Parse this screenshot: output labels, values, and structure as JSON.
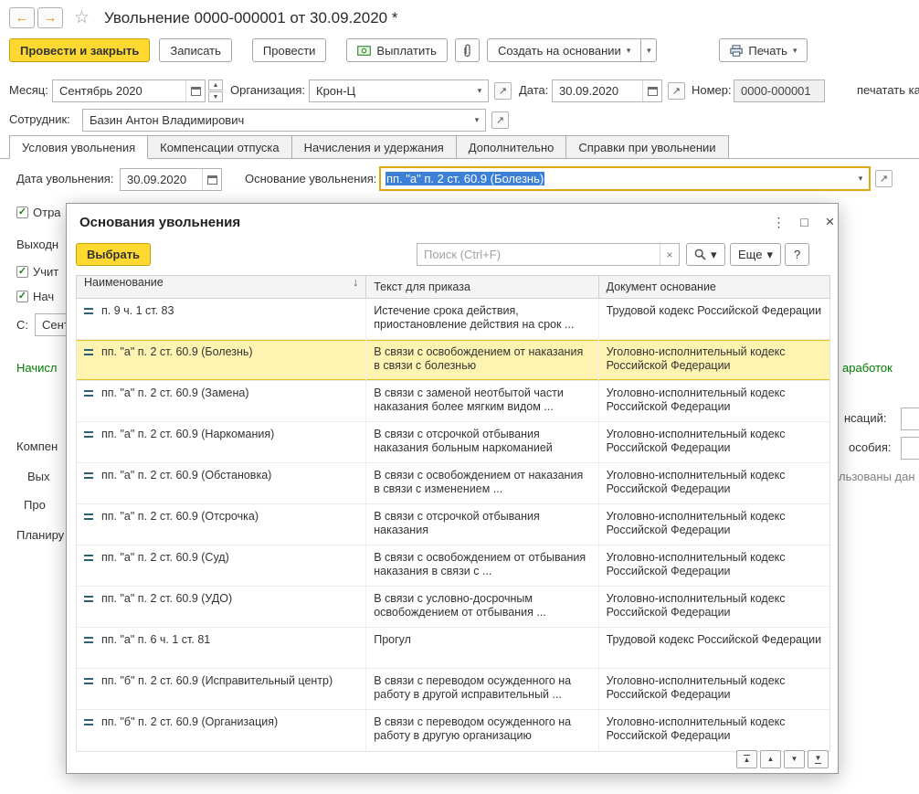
{
  "glyphs": {
    "back": "←",
    "forward": "→",
    "star": "☆",
    "dropdown": "▾",
    "open": "↗",
    "close": "×",
    "maximize": "□",
    "more_dots": "⋮",
    "clear": "×",
    "sort_desc": "↓",
    "check": "✓",
    "up": "▲",
    "down": "▼"
  },
  "window": {
    "title": "Увольнение 0000-000001 от 30.09.2020 *"
  },
  "toolbar": {
    "post_and_close": "Провести и закрыть",
    "write": "Записать",
    "post": "Провести",
    "pay": "Выплатить",
    "create_on_basis": "Создать на основании",
    "print": "Печать"
  },
  "fields": {
    "month_label": "Месяц:",
    "month_value": "Сентябрь 2020",
    "org_label": "Организация:",
    "org_value": "Крон-Ц",
    "date_label": "Дата:",
    "date_value": "30.09.2020",
    "number_label": "Номер:",
    "number_value": "0000-000001",
    "print_hint": "печатать ка",
    "employee_label": "Сотрудник:",
    "employee_value": "Базин Антон Владимирович"
  },
  "tabs": [
    "Условия увольнения",
    "Компенсации отпуска",
    "Начисления и удержания",
    "Дополнительно",
    "Справки при увольнении"
  ],
  "form": {
    "dismissal_date_label": "Дата увольнения:",
    "dismissal_date_value": "30.09.2020",
    "reason_label": "Основание увольнения:",
    "reason_value": "пп. \"а\" п. 2 ст. 60.9 (Болезнь)"
  },
  "background": {
    "otra": "Отра",
    "vyhodn": "Выходн",
    "uchit": "Учит",
    "nach": "Нач",
    "s_label": "С:",
    "s_value": "Сент",
    "nachisl": "Начисл",
    "kompen": "Компен",
    "vyh": "Вых",
    "pro": "Про",
    "planiru": "Планиру",
    "zarabotok": "аработок",
    "nsacij": "нсаций:",
    "osobiya": "особия:",
    "lzovany": "льзованы дан"
  },
  "modal": {
    "title": "Основания увольнения",
    "select_button": "Выбрать",
    "search_placeholder": "Поиск (Ctrl+F)",
    "more_button": "Еще",
    "help_button": "?",
    "columns": [
      "Наименование",
      "Текст для приказа",
      "Документ основание"
    ],
    "rows": [
      {
        "name": "п. 9 ч. 1 ст. 83",
        "text": "Истечение срока действия, приостановление действия на срок ...",
        "doc": "Трудовой кодекс Российской Федерации",
        "selected": false
      },
      {
        "name": "пп. \"а\" п. 2 ст. 60.9 (Болезнь)",
        "text": "В связи с освобождением от наказания в связи с болезнью",
        "doc": "Уголовно-исполнительный кодекс Российской Федерации",
        "selected": true
      },
      {
        "name": "пп. \"а\" п. 2 ст. 60.9 (Замена)",
        "text": "В связи с заменой неотбытой части наказания более мягким видом ...",
        "doc": "Уголовно-исполнительный кодекс Российской Федерации",
        "selected": false
      },
      {
        "name": "пп. \"а\" п. 2 ст. 60.9 (Наркомания)",
        "text": "В связи с отсрочкой отбывания наказания больным наркоманией",
        "doc": "Уголовно-исполнительный кодекс Российской Федерации",
        "selected": false
      },
      {
        "name": "пп. \"а\" п. 2 ст. 60.9 (Обстановка)",
        "text": "В связи с освобождением от наказания в связи с изменением ...",
        "doc": "Уголовно-исполнительный кодекс Российской Федерации",
        "selected": false
      },
      {
        "name": "пп. \"а\" п. 2 ст. 60.9 (Отсрочка)",
        "text": "В связи с отсрочкой отбывания наказания",
        "doc": "Уголовно-исполнительный кодекс Российской Федерации",
        "selected": false
      },
      {
        "name": "пп. \"а\" п. 2 ст. 60.9 (Суд)",
        "text": "В связи с освобождением от отбывания наказания в связи с ...",
        "doc": "Уголовно-исполнительный кодекс Российской Федерации",
        "selected": false
      },
      {
        "name": "пп. \"а\" п. 2 ст. 60.9 (УДО)",
        "text": "В связи с условно-досрочным освобождением от отбывания ...",
        "doc": "Уголовно-исполнительный кодекс Российской Федерации",
        "selected": false
      },
      {
        "name": "пп. \"а\" п. 6 ч. 1 ст. 81",
        "text": "Прогул",
        "doc": "Трудовой кодекс Российской Федерации",
        "selected": false
      },
      {
        "name": "пп. \"б\" п. 2 ст. 60.9 (Исправительный центр)",
        "text": "В связи с переводом осужденного на работу в другой исправительный ...",
        "doc": "Уголовно-исполнительный кодекс Российской Федерации",
        "selected": false
      },
      {
        "name": "пп. \"б\" п. 2 ст. 60.9 (Организация)",
        "text": "В связи с переводом осужденного на работу в другую организацию",
        "doc": "Уголовно-исполнительный кодекс Российской Федерации",
        "selected": false
      }
    ]
  }
}
